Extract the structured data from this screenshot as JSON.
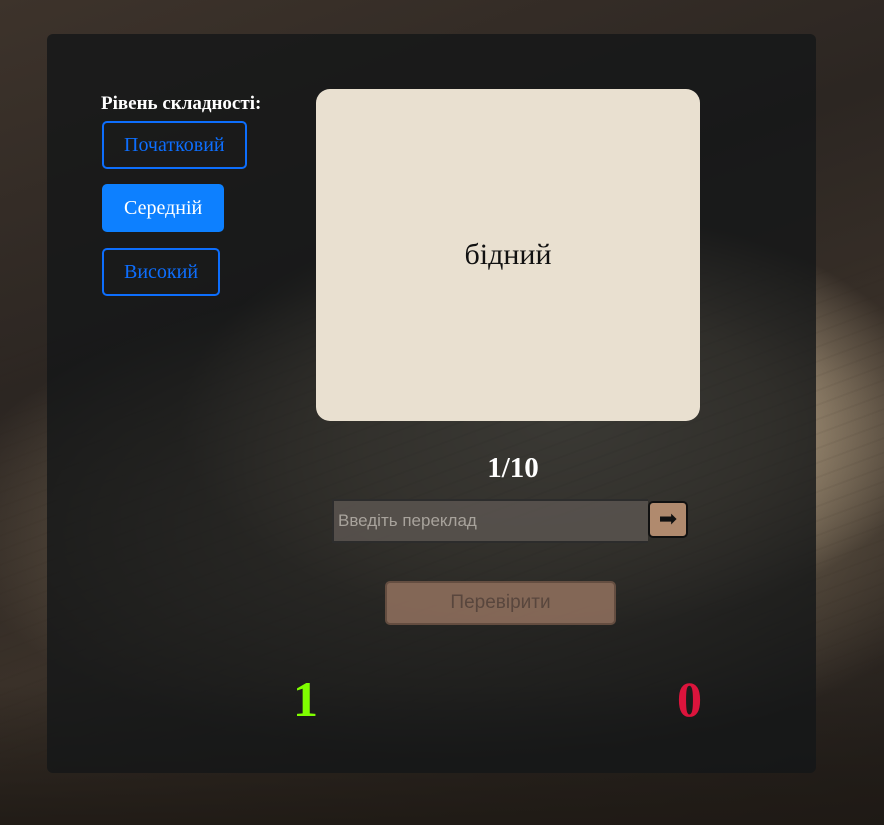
{
  "difficulty": {
    "title": "Рівень складності:",
    "levels": [
      {
        "label": "Початковий",
        "active": false
      },
      {
        "label": "Середній",
        "active": true
      },
      {
        "label": "Високий",
        "active": false
      }
    ]
  },
  "card": {
    "word": "бідний"
  },
  "progress": {
    "text": "1/10"
  },
  "answer": {
    "value": "",
    "placeholder": "Введіть переклад",
    "submit_icon": "➡"
  },
  "check_button": {
    "label": "Перевірити"
  },
  "score": {
    "correct": "1",
    "wrong": "0",
    "correct_color": "#7fff00",
    "wrong_color": "#dc143c"
  },
  "colors": {
    "accent": "#0d6efd",
    "card": "#e9e0d0",
    "button_brown": "#b08a6e"
  }
}
